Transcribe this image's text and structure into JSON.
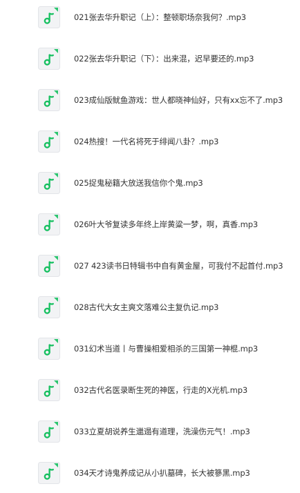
{
  "colors": {
    "icon_background": "#f2f3f5",
    "icon_border": "#e2e4e8",
    "icon_note": "#16c060",
    "text": "#333333",
    "page_background": "#ffffff"
  },
  "file_icon": "music-note-icon",
  "files": [
    {
      "name": "021张去华升职记（上）：整顿职场奈我何？.mp3"
    },
    {
      "name": "022张去华升职记（下）：出来混，迟早要还的.mp3"
    },
    {
      "name": "023成仙版鱿鱼游戏：世人都晓神仙好，只有xx忘不了.mp3"
    },
    {
      "name": "024热搜！一代名将死于绯闻八卦？.mp3"
    },
    {
      "name": "025捉鬼秘籍大放送我信你个鬼.mp3"
    },
    {
      "name": "026叶大爷复读多年终上岸黄粱一梦，啊，真香.mp3"
    },
    {
      "name": "027 423读书日特辑书中自有黄金屋，可我付不起首付.mp3"
    },
    {
      "name": "028古代大女主爽文落难公主复仇记.mp3"
    },
    {
      "name": "031幻术当道丨与曹操相爱相杀的三国第一神棍.mp3"
    },
    {
      "name": "032古代名医录断生死的神医，行走的X光机.mp3"
    },
    {
      "name": "033立夏胡说养生邋遢有道理，洗澡伤元气！.mp3"
    },
    {
      "name": "034天才诗鬼养成记从小扒墓碑，长大被篸黑.mp3"
    }
  ]
}
